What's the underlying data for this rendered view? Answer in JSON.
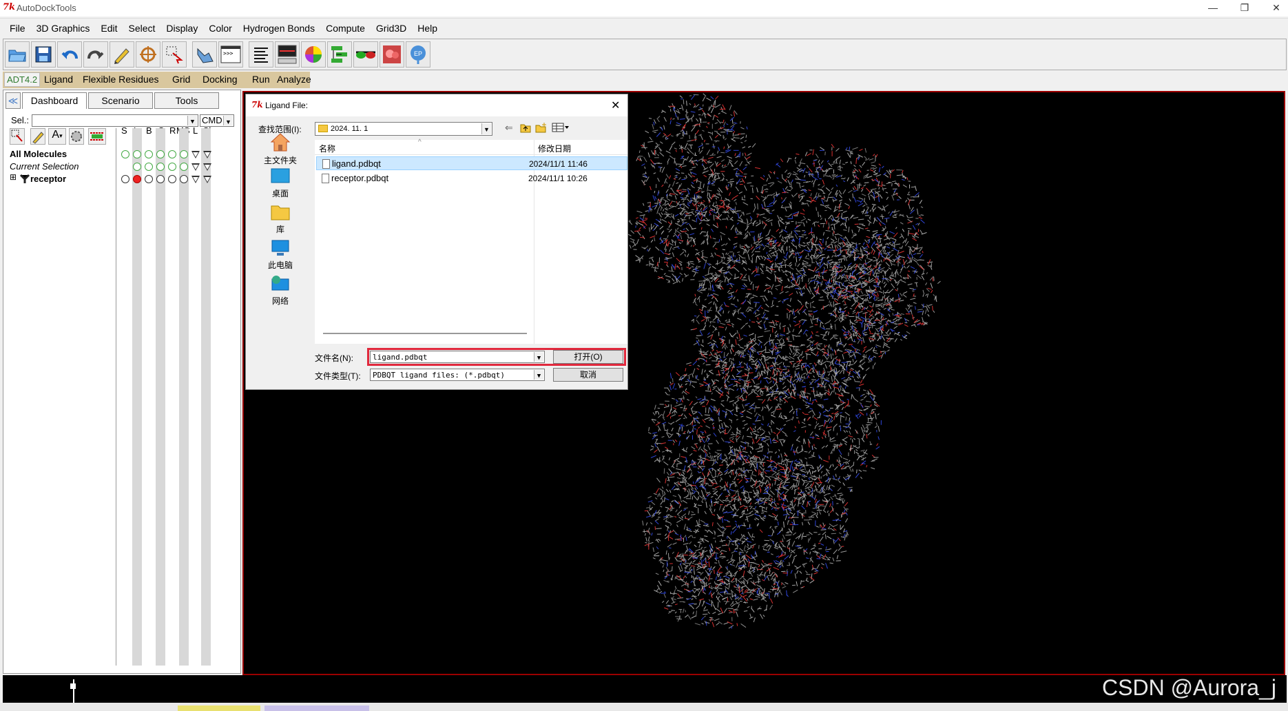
{
  "window": {
    "title": "AutoDockTools",
    "minimize": "—",
    "restore": "❐",
    "close": "✕"
  },
  "menubar": [
    "File",
    "3D Graphics",
    "Edit",
    "Select",
    "Display",
    "Color",
    "Hydrogen Bonds",
    "Compute",
    "Grid3D",
    "Help"
  ],
  "toolbar_icons": [
    "open-icon",
    "save-icon",
    "undo-icon",
    "redo-icon",
    "pencil-icon",
    "target-icon",
    "select-icon",
    "hand-icon",
    "console-icon",
    "align-icon",
    "monitor-icon",
    "color-sphere-icon",
    "network-icon",
    "glasses-icon",
    "movie-icon",
    "info-icon"
  ],
  "adt_menu": {
    "version": "ADT4.2",
    "items": [
      "Ligand",
      "Flexible Residues",
      "Grid",
      "Docking",
      "Run",
      "Analyze"
    ]
  },
  "dashboard": {
    "tabs": [
      "Dashboard",
      "Scenario",
      "Tools"
    ],
    "sel_label": "Sel.:",
    "cmd_label": "CMD",
    "column_letters": [
      "S",
      "L",
      "B",
      "C",
      "R",
      "MS",
      "L",
      "Cl"
    ],
    "tree": [
      {
        "label": "All Molecules"
      },
      {
        "label": "Current Selection"
      },
      {
        "label": "receptor",
        "expander": "⊞"
      }
    ]
  },
  "dialog": {
    "title": "Ligand File:",
    "close": "✕",
    "lookin_label": "查找范围(I):",
    "lookin_value": "2024. 11. 1",
    "places": [
      "主文件夹",
      "桌面",
      "库",
      "此电脑",
      "网络"
    ],
    "columns": {
      "name": "名称",
      "date": "修改日期"
    },
    "files": [
      {
        "name": "ligand.pdbqt",
        "date": "2024/11/1 11:46",
        "selected": true
      },
      {
        "name": "receptor.pdbqt",
        "date": "2024/11/1 10:26",
        "selected": false
      }
    ],
    "filename_label": "文件名(N):",
    "filename_value": "ligand.pdbqt",
    "filetype_label": "文件类型(T):",
    "filetype_value": "PDBQT ligand files: (*.pdbqt)",
    "open_button": "打开(O)",
    "cancel_button": "取消"
  },
  "watermark": "CSDN @Aurora_j",
  "colors": {
    "viewer_bg": "#000000",
    "viewer_border": "#9b0000",
    "highlight_box": "#e0283c",
    "selected_row": "#cce8ff",
    "adt_bar": "#d9c79e"
  }
}
